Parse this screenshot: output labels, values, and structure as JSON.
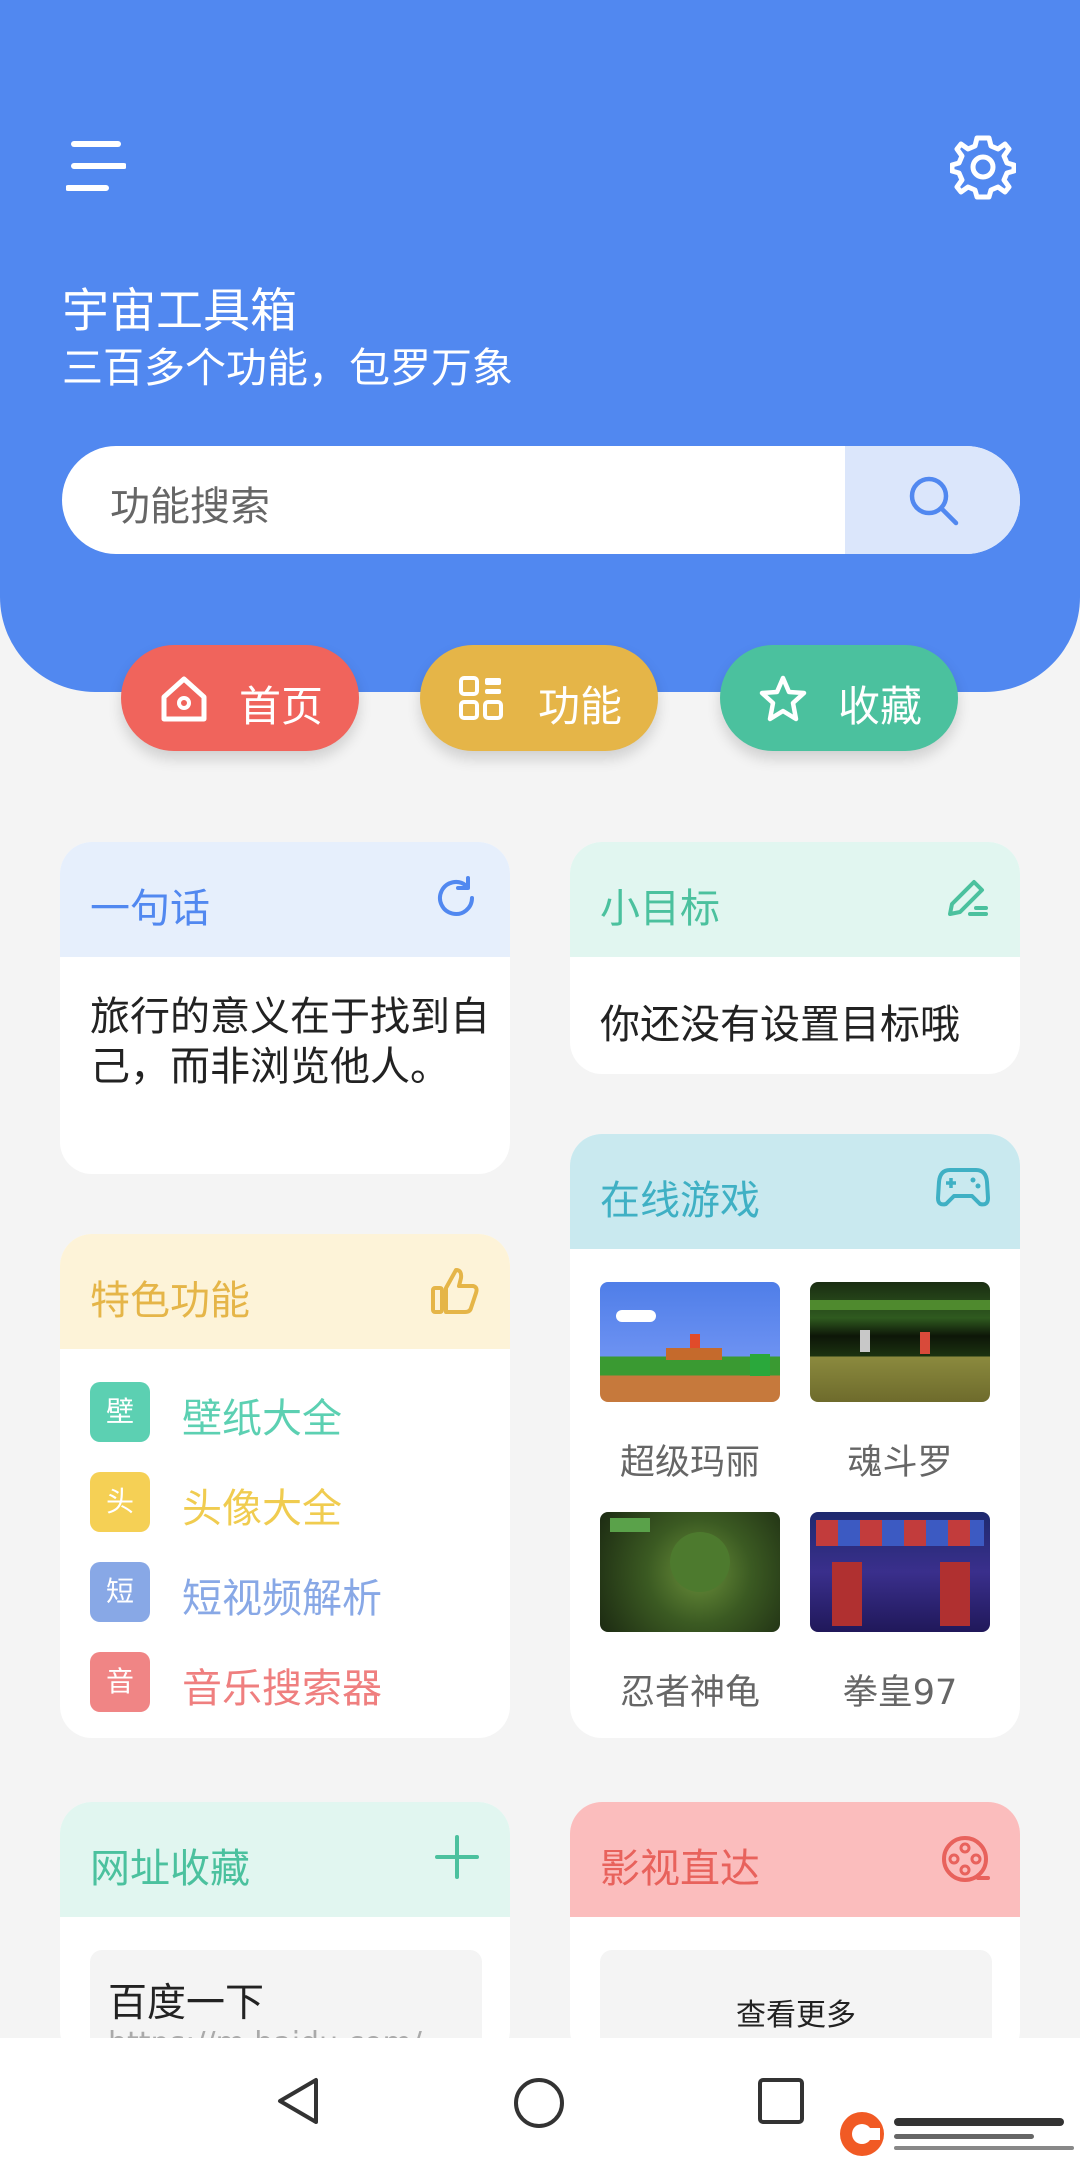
{
  "header": {
    "title": "宇宙工具箱",
    "subtitle": "三百多个功能，包罗万象"
  },
  "search": {
    "placeholder": "功能搜索"
  },
  "tabs": [
    {
      "label": "首页"
    },
    {
      "label": "功能"
    },
    {
      "label": "收藏"
    }
  ],
  "quote_card": {
    "title": "一句话",
    "text": "旅行的意义在于找到自己，而非浏览他人。"
  },
  "goal_card": {
    "title": "小目标",
    "text": "你还没有设置目标哦"
  },
  "features_card": {
    "title": "特色功能",
    "items": [
      {
        "badge": "壁",
        "label": "壁纸大全"
      },
      {
        "badge": "头",
        "label": "头像大全"
      },
      {
        "badge": "短",
        "label": "短视频解析"
      },
      {
        "badge": "音",
        "label": "音乐搜索器"
      }
    ]
  },
  "games_card": {
    "title": "在线游戏",
    "games": [
      {
        "label": "超级玛丽"
      },
      {
        "label": "魂斗罗"
      },
      {
        "label": "忍者神龟"
      },
      {
        "label": "拳皇97"
      }
    ]
  },
  "bookmarks_card": {
    "title": "网址收藏",
    "site_name": "百度一下",
    "site_url": "https://m.baidu.com/"
  },
  "movies_card": {
    "title": "影视直达",
    "more_label": "查看更多"
  },
  "colors": {
    "primary": "#5188f0",
    "home": "#f0645c",
    "functions": "#e5b548",
    "favorites": "#4bc19e"
  }
}
